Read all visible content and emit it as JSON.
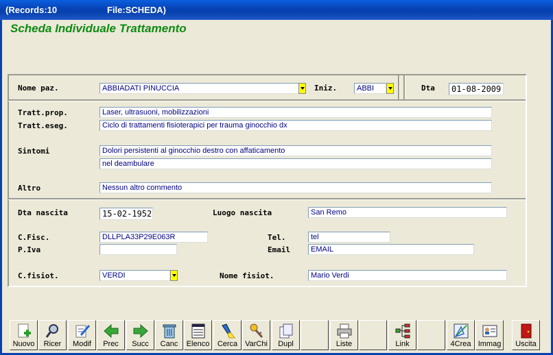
{
  "window": {
    "records": "(Records:10",
    "file": "File:SCHEDA)"
  },
  "heading": "Scheda Individuale Trattamento",
  "form": {
    "nome_paz": {
      "label": "Nome paz.",
      "value": "ABBIADATI PINUCCIA"
    },
    "iniz": {
      "label": "Iniz.",
      "value": "ABBI"
    },
    "dta": {
      "label": "Dta",
      "value": "01-08-2009"
    },
    "tratt_prop": {
      "label": "Tratt.prop.",
      "value": "Laser, ultrasuoni, mobilizzazioni"
    },
    "tratt_eseg": {
      "label": "Tratt.eseg.",
      "value": "Ciclo di trattamenti fisioterapici per trauma ginocchio dx"
    },
    "sintomi": {
      "label": "Sintomi",
      "line1": "Dolori persistenti al ginocchio destro con affaticamento",
      "line2": "nel deambulare"
    },
    "altro": {
      "label": "Altro",
      "value": "Nessun altro commento"
    },
    "dta_nascita": {
      "label": "Dta nascita",
      "value": "15-02-1952"
    },
    "luogo_nascita": {
      "label": "Luogo nascita",
      "value": "San Remo"
    },
    "c_fisc": {
      "label": "C.Fisc.",
      "value": "DLLPLA33P29E063R"
    },
    "tel": {
      "label": "Tel.",
      "value": "tel"
    },
    "p_iva": {
      "label": "P.Iva",
      "value": ""
    },
    "email": {
      "label": "Email",
      "value": "EMAIL"
    },
    "c_fisiot": {
      "label": "C.fisiot.",
      "value": "VERDI"
    },
    "nome_fisiot": {
      "label": "Nome fisiot.",
      "value": "Mario Verdi"
    }
  },
  "toolbar": {
    "nuovo": "Nuovo",
    "ricer": "Ricer",
    "modif": "Modif",
    "prec": "Prec",
    "succ": "Succ",
    "canc": "Canc",
    "elenco": "Elenco",
    "cerca": "Cerca",
    "varchi": "VarChi",
    "dupl": "Dupl",
    "liste": "Liste",
    "link": "Link",
    "crea": "4Crea",
    "immag": "Immag",
    "uscita": "Uscita"
  },
  "colors": {
    "title_bar": "#0842b4",
    "heading": "#0f8a12",
    "field_text": "#000080",
    "dropdown": "#ffff00",
    "background": "#ece9d8"
  }
}
